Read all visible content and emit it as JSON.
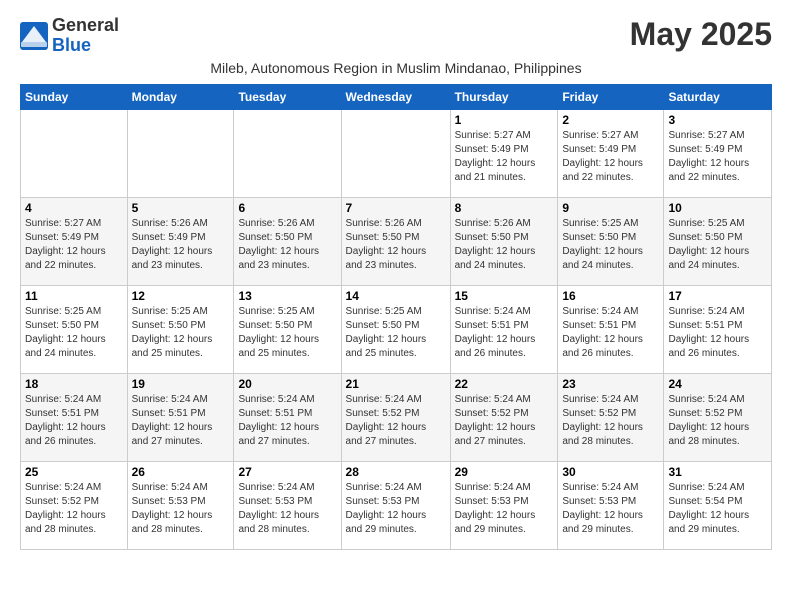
{
  "header": {
    "logo_line1": "General",
    "logo_line2": "Blue",
    "month_title": "May 2025",
    "subtitle": "Mileb, Autonomous Region in Muslim Mindanao, Philippines"
  },
  "weekdays": [
    "Sunday",
    "Monday",
    "Tuesday",
    "Wednesday",
    "Thursday",
    "Friday",
    "Saturday"
  ],
  "weeks": [
    [
      {
        "day": "",
        "info": ""
      },
      {
        "day": "",
        "info": ""
      },
      {
        "day": "",
        "info": ""
      },
      {
        "day": "",
        "info": ""
      },
      {
        "day": "1",
        "info": "Sunrise: 5:27 AM\nSunset: 5:49 PM\nDaylight: 12 hours\nand 21 minutes."
      },
      {
        "day": "2",
        "info": "Sunrise: 5:27 AM\nSunset: 5:49 PM\nDaylight: 12 hours\nand 22 minutes."
      },
      {
        "day": "3",
        "info": "Sunrise: 5:27 AM\nSunset: 5:49 PM\nDaylight: 12 hours\nand 22 minutes."
      }
    ],
    [
      {
        "day": "4",
        "info": "Sunrise: 5:27 AM\nSunset: 5:49 PM\nDaylight: 12 hours\nand 22 minutes."
      },
      {
        "day": "5",
        "info": "Sunrise: 5:26 AM\nSunset: 5:49 PM\nDaylight: 12 hours\nand 23 minutes."
      },
      {
        "day": "6",
        "info": "Sunrise: 5:26 AM\nSunset: 5:50 PM\nDaylight: 12 hours\nand 23 minutes."
      },
      {
        "day": "7",
        "info": "Sunrise: 5:26 AM\nSunset: 5:50 PM\nDaylight: 12 hours\nand 23 minutes."
      },
      {
        "day": "8",
        "info": "Sunrise: 5:26 AM\nSunset: 5:50 PM\nDaylight: 12 hours\nand 24 minutes."
      },
      {
        "day": "9",
        "info": "Sunrise: 5:25 AM\nSunset: 5:50 PM\nDaylight: 12 hours\nand 24 minutes."
      },
      {
        "day": "10",
        "info": "Sunrise: 5:25 AM\nSunset: 5:50 PM\nDaylight: 12 hours\nand 24 minutes."
      }
    ],
    [
      {
        "day": "11",
        "info": "Sunrise: 5:25 AM\nSunset: 5:50 PM\nDaylight: 12 hours\nand 24 minutes."
      },
      {
        "day": "12",
        "info": "Sunrise: 5:25 AM\nSunset: 5:50 PM\nDaylight: 12 hours\nand 25 minutes."
      },
      {
        "day": "13",
        "info": "Sunrise: 5:25 AM\nSunset: 5:50 PM\nDaylight: 12 hours\nand 25 minutes."
      },
      {
        "day": "14",
        "info": "Sunrise: 5:25 AM\nSunset: 5:50 PM\nDaylight: 12 hours\nand 25 minutes."
      },
      {
        "day": "15",
        "info": "Sunrise: 5:24 AM\nSunset: 5:51 PM\nDaylight: 12 hours\nand 26 minutes."
      },
      {
        "day": "16",
        "info": "Sunrise: 5:24 AM\nSunset: 5:51 PM\nDaylight: 12 hours\nand 26 minutes."
      },
      {
        "day": "17",
        "info": "Sunrise: 5:24 AM\nSunset: 5:51 PM\nDaylight: 12 hours\nand 26 minutes."
      }
    ],
    [
      {
        "day": "18",
        "info": "Sunrise: 5:24 AM\nSunset: 5:51 PM\nDaylight: 12 hours\nand 26 minutes."
      },
      {
        "day": "19",
        "info": "Sunrise: 5:24 AM\nSunset: 5:51 PM\nDaylight: 12 hours\nand 27 minutes."
      },
      {
        "day": "20",
        "info": "Sunrise: 5:24 AM\nSunset: 5:51 PM\nDaylight: 12 hours\nand 27 minutes."
      },
      {
        "day": "21",
        "info": "Sunrise: 5:24 AM\nSunset: 5:52 PM\nDaylight: 12 hours\nand 27 minutes."
      },
      {
        "day": "22",
        "info": "Sunrise: 5:24 AM\nSunset: 5:52 PM\nDaylight: 12 hours\nand 27 minutes."
      },
      {
        "day": "23",
        "info": "Sunrise: 5:24 AM\nSunset: 5:52 PM\nDaylight: 12 hours\nand 28 minutes."
      },
      {
        "day": "24",
        "info": "Sunrise: 5:24 AM\nSunset: 5:52 PM\nDaylight: 12 hours\nand 28 minutes."
      }
    ],
    [
      {
        "day": "25",
        "info": "Sunrise: 5:24 AM\nSunset: 5:52 PM\nDaylight: 12 hours\nand 28 minutes."
      },
      {
        "day": "26",
        "info": "Sunrise: 5:24 AM\nSunset: 5:53 PM\nDaylight: 12 hours\nand 28 minutes."
      },
      {
        "day": "27",
        "info": "Sunrise: 5:24 AM\nSunset: 5:53 PM\nDaylight: 12 hours\nand 28 minutes."
      },
      {
        "day": "28",
        "info": "Sunrise: 5:24 AM\nSunset: 5:53 PM\nDaylight: 12 hours\nand 29 minutes."
      },
      {
        "day": "29",
        "info": "Sunrise: 5:24 AM\nSunset: 5:53 PM\nDaylight: 12 hours\nand 29 minutes."
      },
      {
        "day": "30",
        "info": "Sunrise: 5:24 AM\nSunset: 5:53 PM\nDaylight: 12 hours\nand 29 minutes."
      },
      {
        "day": "31",
        "info": "Sunrise: 5:24 AM\nSunset: 5:54 PM\nDaylight: 12 hours\nand 29 minutes."
      }
    ]
  ]
}
